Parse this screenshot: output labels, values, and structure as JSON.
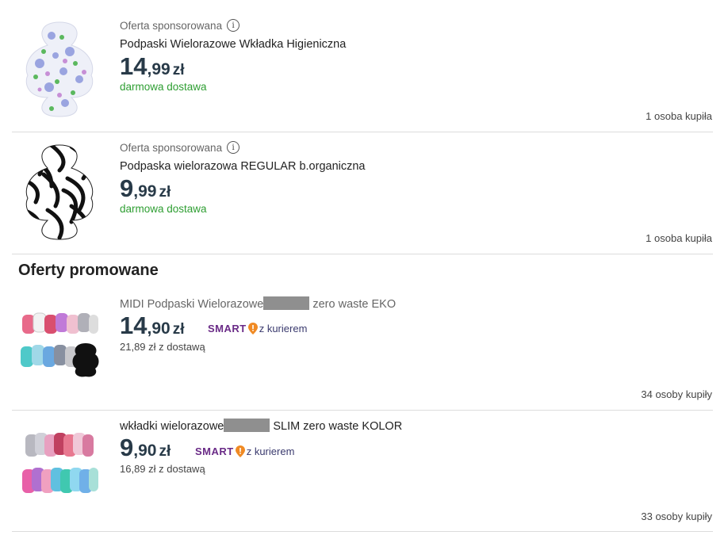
{
  "listings": [
    {
      "sponsored": "Oferta sponsorowana",
      "title": "Podpaski Wielorazowe Wkładka Higieniczna",
      "price_int": "14",
      "price_dec": ",99",
      "currency": "zł",
      "delivery": "darmowa dostawa",
      "sold": "1 osoba kupiła",
      "image": "floral-pad-image"
    },
    {
      "sponsored": "Oferta sponsorowana",
      "title": "Podpaska wielorazowa REGULAR b.organiczna",
      "price_int": "9",
      "price_dec": ",99",
      "currency": "zł",
      "delivery": "darmowa dostawa",
      "sold": "1 osoba kupiła",
      "image": "zebra-pad-image"
    }
  ],
  "promoted": {
    "heading": "Oferty promowane",
    "items": [
      {
        "title_pre": "MIDI Podpaski Wielorazowe",
        "title_post": " zero waste EKO",
        "price_int": "14",
        "price_dec": ",90",
        "currency": "zł",
        "smart_logo": "SMART",
        "smart_text": "z kurierem",
        "shipping": "21,89 zł z dostawą",
        "sold": "34 osoby kupiły",
        "image": "pad-set-image"
      },
      {
        "title_pre": "wkładki wielorazowe",
        "title_post": " SLIM zero waste KOLOR",
        "price_int": "9",
        "price_dec": ",90",
        "currency": "zł",
        "smart_logo": "SMART",
        "smart_text": "z kurierem",
        "shipping": "16,89 zł z dostawą",
        "sold": "33 osoby kupiły",
        "image": "liner-set-image"
      }
    ]
  },
  "colors": {
    "price": "#283a48",
    "free_delivery": "#2e9e32",
    "smart": "#6a2b87",
    "smart_pin": "#f08a24"
  }
}
